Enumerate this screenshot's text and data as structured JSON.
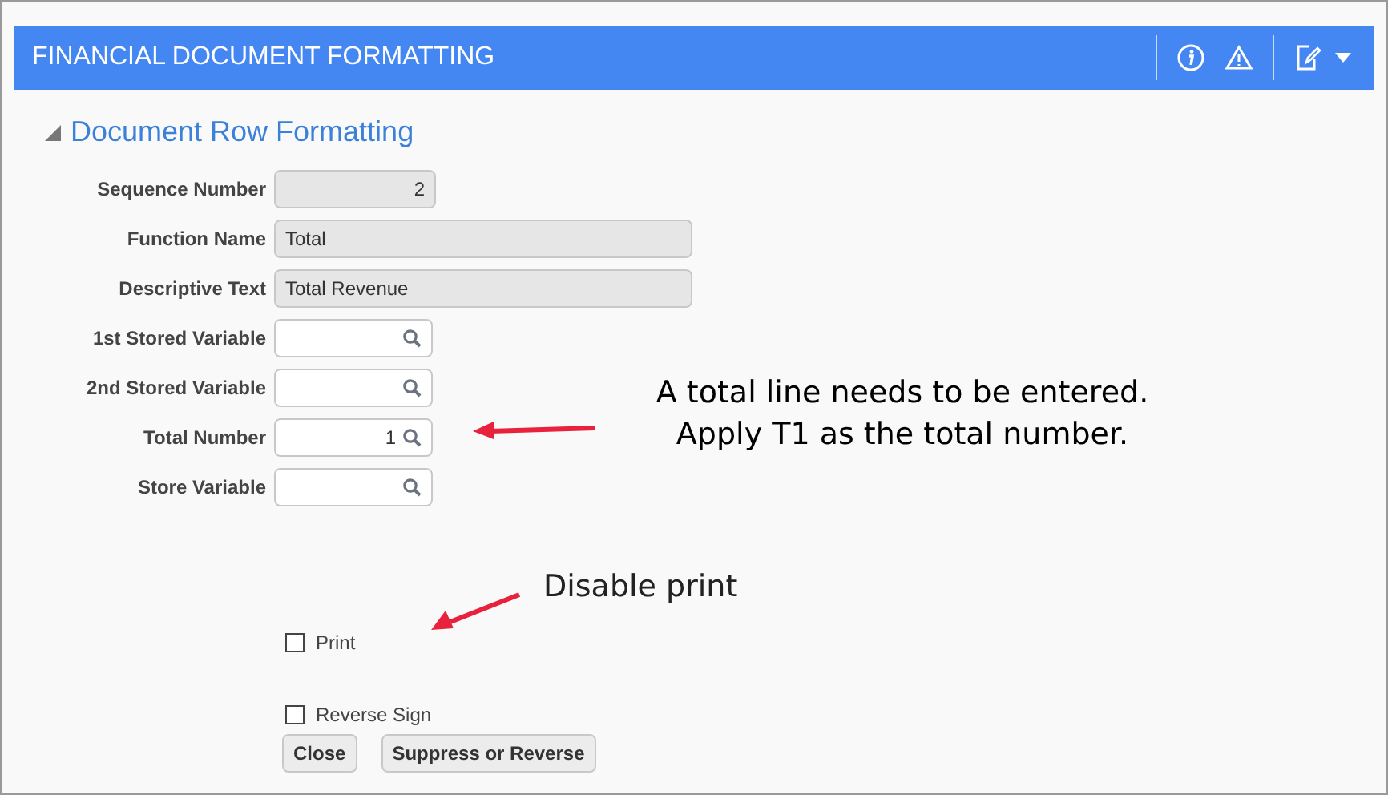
{
  "window": {
    "title": "FINANCIAL DOCUMENT FORMATTING"
  },
  "section": {
    "title": "Document Row Formatting",
    "expanded": true
  },
  "fields": [
    {
      "label": "Sequence Number",
      "value": "2",
      "kind": "number"
    },
    {
      "label": "Function Name",
      "value": "Total",
      "kind": "readonly"
    },
    {
      "label": "Descriptive Text",
      "value": "Total Revenue",
      "kind": "readonly"
    },
    {
      "label": "1st Stored Variable",
      "kind": "lookup"
    },
    {
      "label": "2nd Stored Variable",
      "kind": "lookup"
    },
    {
      "label": "Total Number",
      "value": "1",
      "kind": "lookup"
    },
    {
      "label": "Store Variable",
      "kind": "lookup"
    }
  ],
  "checkboxes": [
    {
      "label": "Print",
      "checked": false
    },
    {
      "label": "Reverse Sign",
      "checked": false
    }
  ],
  "buttons": [
    "Close",
    "Suppress or Reverse"
  ],
  "annotations": [
    {
      "lines": [
        "A total line needs to be entered.",
        "Apply T1 as the total number."
      ]
    },
    {
      "lines": [
        "Disable print"
      ]
    }
  ]
}
